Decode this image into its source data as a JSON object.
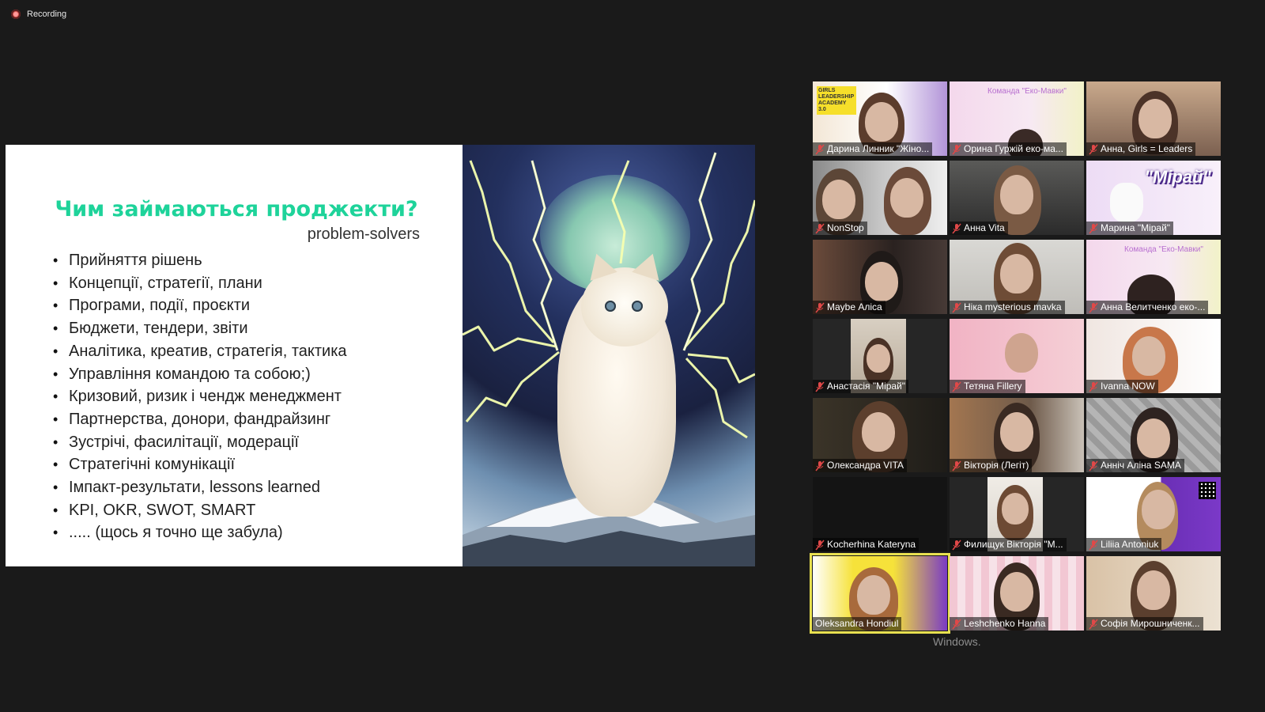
{
  "recording": {
    "label": "Recording"
  },
  "slide": {
    "title": "Чим займаються проджекти?",
    "subtitle": "problem-solvers",
    "bullets": [
      "Прийняття рішень",
      "Концепції, стратегії, плани",
      "Програми, події, проєкти",
      "Бюджети, тендери, звіти",
      "Аналітика, креатив, стратегія, тактика",
      "Управління командою та собою;)",
      "Кризовий, ризик і чендж менеджмент",
      "Партнерства, донори, фандрайзинг",
      "Зустрічі, фасилітації, модерації",
      "Стратегічні комунікації",
      "Імпакт-результати, lessons learned",
      "KPI, OKR, SWOT, SMART",
      "..... (щось я точно ще забула)"
    ]
  },
  "participants": [
    {
      "name": "Дарина Линник \"Жіно...",
      "muted": true,
      "banner": "GIRLS LEADERSHIP ACADEMY 3.0"
    },
    {
      "name": "Орина Гуржій еко-ма...",
      "muted": true,
      "banner": "Команда \"Еко-Мавки\""
    },
    {
      "name": "Анна, Girls = Leaders",
      "muted": true
    },
    {
      "name": "NonStop",
      "muted": true
    },
    {
      "name": "Анна Vita",
      "muted": true
    },
    {
      "name": "Марина \"Мірай\"",
      "muted": true,
      "banner": "\"Мірай\""
    },
    {
      "name": "Maybe Аліса",
      "muted": true
    },
    {
      "name": "Ніка mysterious mavka",
      "muted": true
    },
    {
      "name": "Анна Велитченко еко-...",
      "muted": true,
      "banner": "Команда \"Еко-Мавки\""
    },
    {
      "name": "Анастасія \"Мірай\"",
      "muted": true
    },
    {
      "name": "Тетяна Fillery",
      "muted": true
    },
    {
      "name": "Ivanna NOW",
      "muted": true
    },
    {
      "name": "Олександра VITA",
      "muted": true
    },
    {
      "name": "Вікторія (Легіт)",
      "muted": true
    },
    {
      "name": "Анніч Аліна SAMA",
      "muted": true
    },
    {
      "name": "Kocherhina Kateryna",
      "muted": true
    },
    {
      "name": "Филищук Вікторія \"M...",
      "muted": true
    },
    {
      "name": "Liliia Antoniuk",
      "muted": true
    },
    {
      "name": "Oleksandra Hondiul",
      "muted": false,
      "active": true
    },
    {
      "name": "Leshchenko Hanna",
      "muted": true
    },
    {
      "name": "Софія Мирошниченк...",
      "muted": true
    }
  ],
  "watermark": "Windows."
}
